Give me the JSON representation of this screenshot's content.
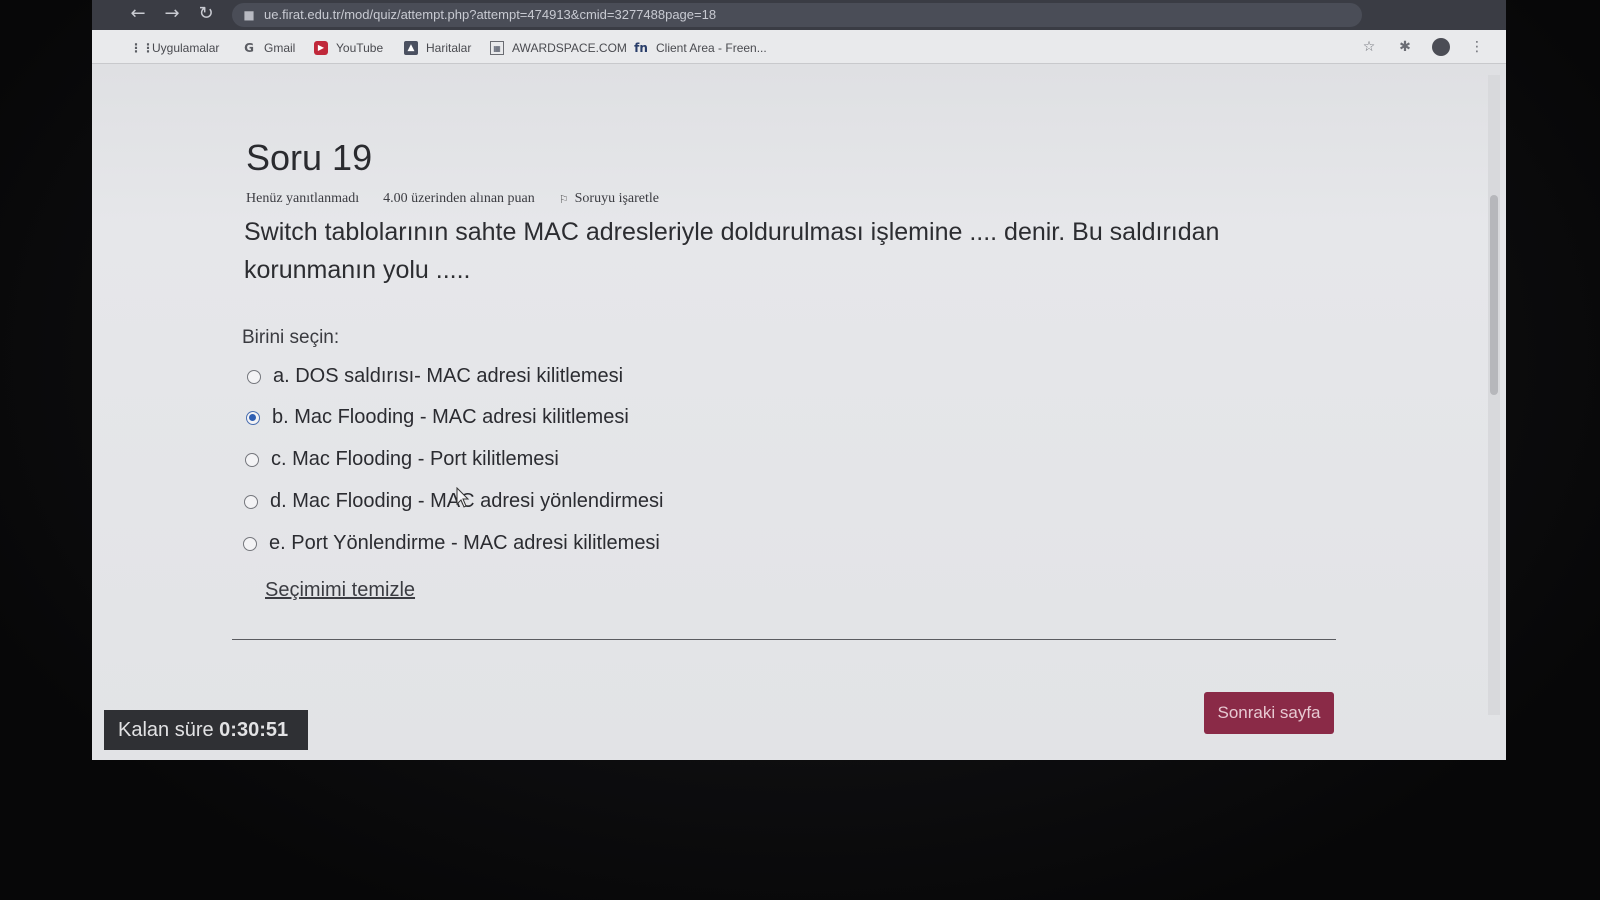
{
  "browser": {
    "url": "ue.firat.edu.tr/mod/quiz/attempt.php?attempt=474913&cmid=3277488page=18",
    "bookmarks": [
      {
        "label": "Uygulamalar",
        "icon": "apps-grid-icon"
      },
      {
        "label": "Gmail",
        "icon": "google-icon"
      },
      {
        "label": "YouTube",
        "icon": "youtube-icon"
      },
      {
        "label": "Haritalar",
        "icon": "maps-icon"
      },
      {
        "label": "AWARDSPACE.COM",
        "icon": "awardspace-icon"
      },
      {
        "label": "Client Area - Freen...",
        "icon": "freenom-icon"
      }
    ]
  },
  "quiz": {
    "title": "Soru 19",
    "status": "Henüz yanıtlanmadı",
    "points": "4.00 üzerinden alınan puan",
    "flag_label": "Soruyu işaretle",
    "question_text": "Switch tablolarının sahte MAC adresleriyle doldurulması işlemine .... denir. Bu saldırıdan korunmanın yolu .....",
    "prompt": "Birini seçin:",
    "options": [
      {
        "label": "a. DOS saldırısı- MAC adresi kilitlemesi",
        "selected": false
      },
      {
        "label": "b. Mac Flooding - MAC adresi kilitlemesi",
        "selected": true
      },
      {
        "label": "c. Mac Flooding - Port kilitlemesi",
        "selected": false
      },
      {
        "label": "d. Mac Flooding - MAC adresi yönlendirmesi",
        "selected": false
      },
      {
        "label": "e. Port Yönlendirme - MAC adresi kilitlemesi",
        "selected": false
      }
    ],
    "clear_label": "Seçimimi temizle",
    "next_label": "Sonraki sayfa"
  },
  "timer": {
    "label": "Kalan süre",
    "value": "0:30:51"
  },
  "colors": {
    "accent": "#8a2a47",
    "radio_selected": "#2f5fb3",
    "timer_bg": "#2f3034"
  }
}
